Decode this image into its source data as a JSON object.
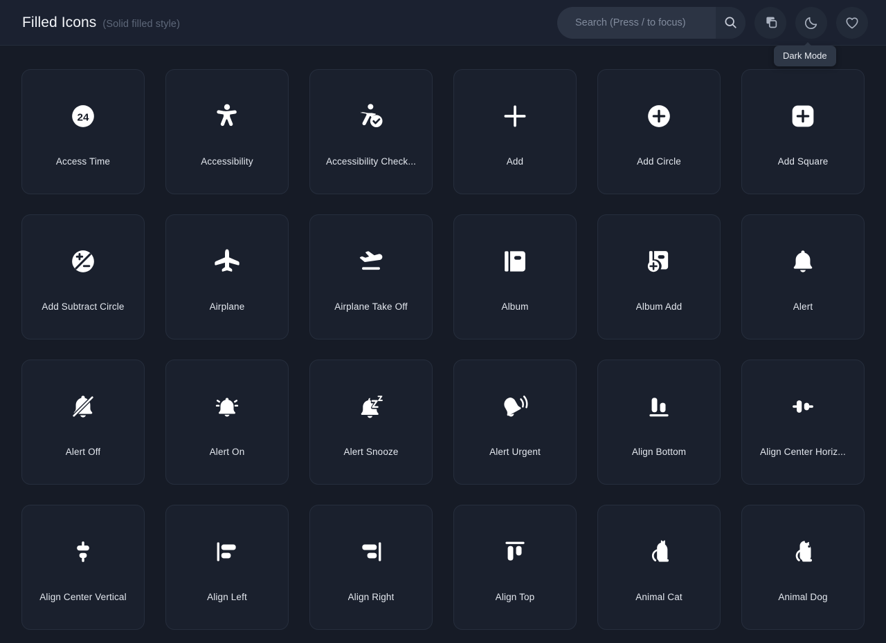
{
  "header": {
    "title": "Filled Icons",
    "subtitle": "(Solid filled style)",
    "search": {
      "placeholder": "Search (Press / to focus)",
      "value": ""
    },
    "buttons": [
      {
        "name": "copy-icon",
        "label": "Copy"
      },
      {
        "name": "moon-icon",
        "label": "Dark Mode"
      },
      {
        "name": "heart-icon",
        "label": "Favorites"
      }
    ],
    "tooltip": "Dark Mode"
  },
  "colors": {
    "page_background": "#161b26",
    "header_background": "#1b2130",
    "card_background": "#1a202d",
    "card_border": "#262e3d",
    "icon_color": "#ffffff",
    "label_color": "#e3e7ee",
    "subtitle_color": "#5d6779",
    "tooltip_background": "#2e3746"
  },
  "grid": {
    "columns": 6,
    "items": [
      {
        "label": "Access Time",
        "icon": "access-time-icon"
      },
      {
        "label": "Accessibility",
        "icon": "accessibility-icon"
      },
      {
        "label": "Accessibility Check...",
        "icon": "accessibility-check-icon"
      },
      {
        "label": "Add",
        "icon": "add-icon"
      },
      {
        "label": "Add Circle",
        "icon": "add-circle-icon"
      },
      {
        "label": "Add Square",
        "icon": "add-square-icon"
      },
      {
        "label": "Add Subtract Circle",
        "icon": "add-subtract-circle-icon"
      },
      {
        "label": "Airplane",
        "icon": "airplane-icon"
      },
      {
        "label": "Airplane Take Off",
        "icon": "airplane-take-off-icon"
      },
      {
        "label": "Album",
        "icon": "album-icon"
      },
      {
        "label": "Album Add",
        "icon": "album-add-icon"
      },
      {
        "label": "Alert",
        "icon": "alert-icon"
      },
      {
        "label": "Alert Off",
        "icon": "alert-off-icon"
      },
      {
        "label": "Alert On",
        "icon": "alert-on-icon"
      },
      {
        "label": "Alert Snooze",
        "icon": "alert-snooze-icon"
      },
      {
        "label": "Alert Urgent",
        "icon": "alert-urgent-icon"
      },
      {
        "label": "Align Bottom",
        "icon": "align-bottom-icon"
      },
      {
        "label": "Align Center Horiz...",
        "icon": "align-center-horizontal-icon"
      },
      {
        "label": "Align Center Vertical",
        "icon": "align-center-vertical-icon"
      },
      {
        "label": "Align Left",
        "icon": "align-left-icon"
      },
      {
        "label": "Align Right",
        "icon": "align-right-icon"
      },
      {
        "label": "Align Top",
        "icon": "align-top-icon"
      },
      {
        "label": "Animal Cat",
        "icon": "animal-cat-icon"
      },
      {
        "label": "Animal Dog",
        "icon": "animal-dog-icon"
      }
    ]
  }
}
